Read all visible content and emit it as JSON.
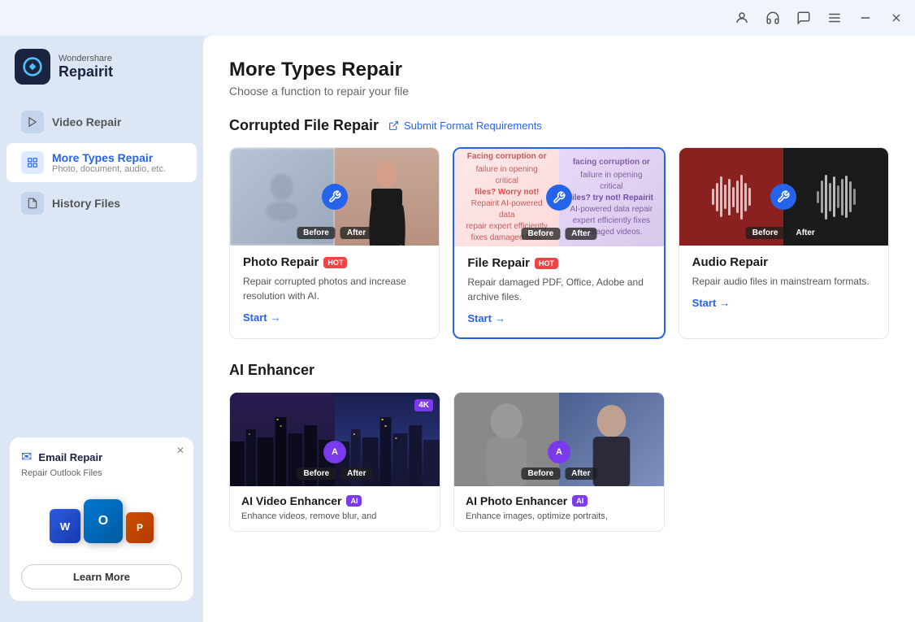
{
  "titlebar": {
    "icons": [
      "account-icon",
      "headset-icon",
      "chat-icon",
      "menu-icon",
      "minimize-icon",
      "close-icon"
    ]
  },
  "sidebar": {
    "logo": {
      "brand": "Wondershare",
      "name": "Repairit"
    },
    "items": [
      {
        "id": "video-repair",
        "label": "Video Repair",
        "sub": "",
        "active": false
      },
      {
        "id": "more-types-repair",
        "label": "More Types Repair",
        "sub": "Photo, document, audio, etc.",
        "active": true
      },
      {
        "id": "history-files",
        "label": "History Files",
        "sub": "",
        "active": false
      }
    ],
    "promo": {
      "icon": "✉",
      "title": "Email Repair",
      "subtitle": "Repair Outlook Files",
      "learn_more": "Learn More"
    }
  },
  "main": {
    "title": "More Types Repair",
    "subtitle": "Choose a function to repair your file",
    "sections": [
      {
        "id": "corrupted-file-repair",
        "title": "Corrupted File Repair",
        "link_label": "Submit Format Requirements",
        "cards": [
          {
            "id": "photo-repair",
            "title": "Photo Repair",
            "badge": "HOT",
            "desc": "Repair corrupted photos and increase resolution with AI.",
            "start_label": "Start"
          },
          {
            "id": "file-repair",
            "title": "File Repair",
            "badge": "HOT",
            "desc": "Repair damaged PDF, Office, Adobe and archive files.",
            "start_label": "Start",
            "selected": true
          },
          {
            "id": "audio-repair",
            "title": "Audio Repair",
            "badge": "",
            "desc": "Repair audio files in mainstream formats.",
            "start_label": "Start"
          }
        ]
      },
      {
        "id": "ai-enhancer",
        "title": "AI Enhancer",
        "cards": [
          {
            "id": "ai-video-enhancer",
            "title": "AI Video Enhancer",
            "badge": "AI",
            "desc": "Enhance videos, remove blur, and",
            "badge_4k": "4K"
          },
          {
            "id": "ai-photo-enhancer",
            "title": "AI Photo Enhancer",
            "badge": "AI",
            "desc": "Enhance images, optimize portraits,"
          }
        ]
      }
    ]
  }
}
